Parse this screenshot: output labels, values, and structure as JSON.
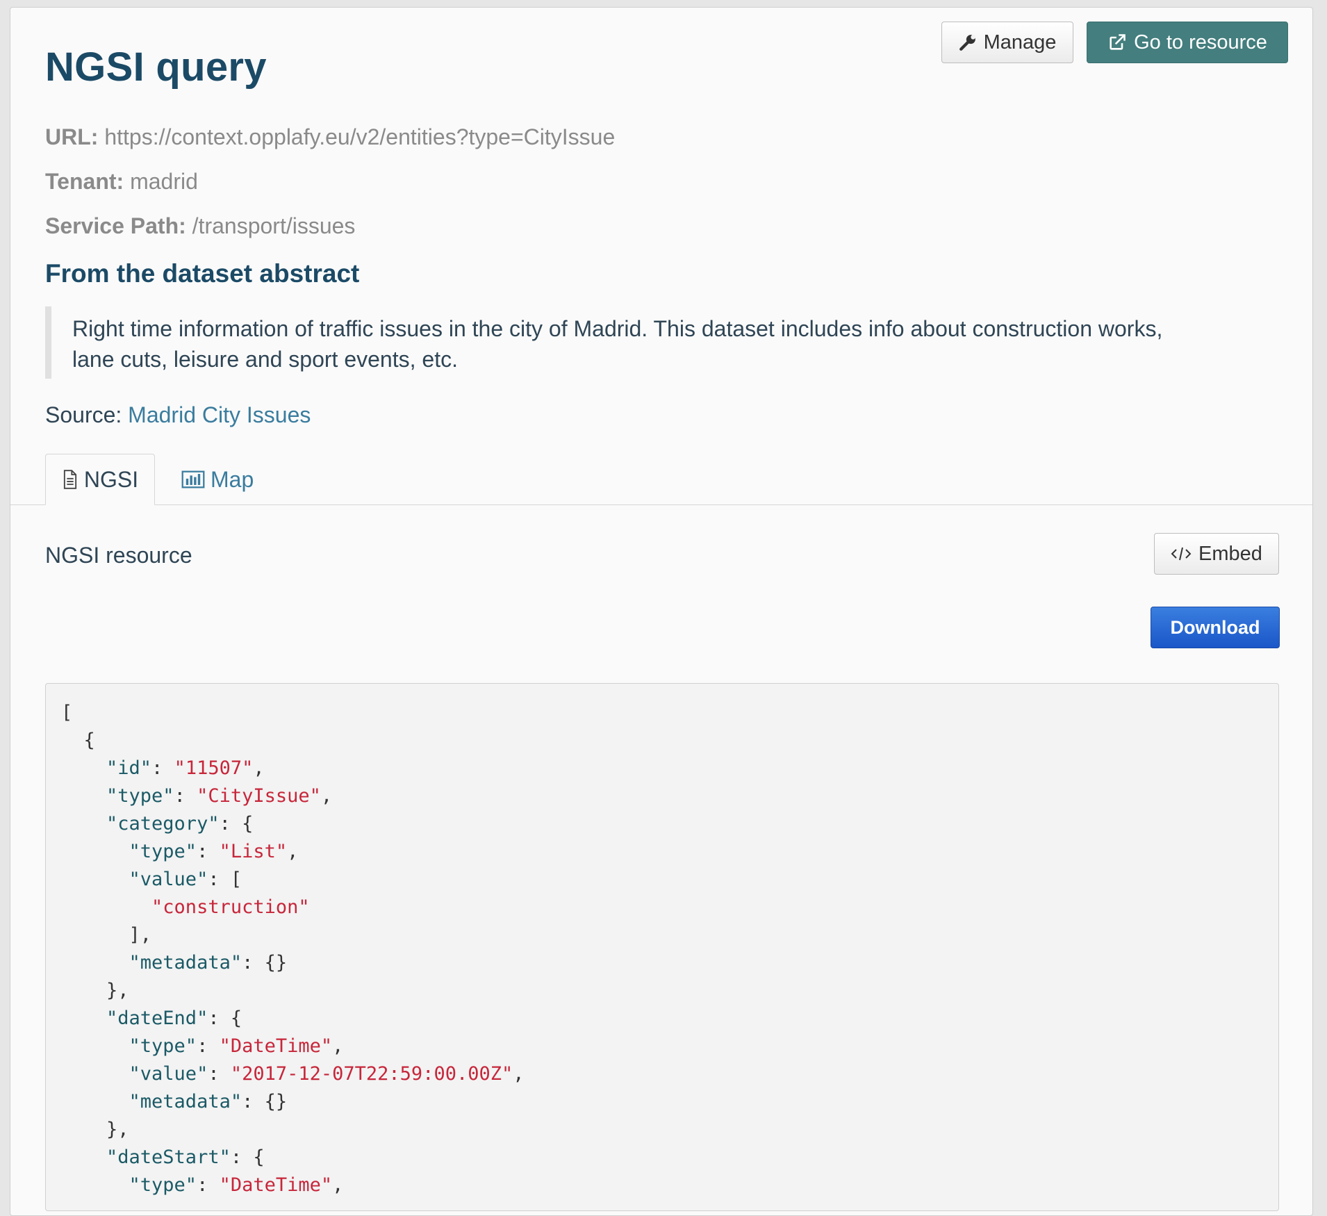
{
  "header": {
    "title": "NGSI query",
    "manage_label": "Manage",
    "goto_label": "Go to resource"
  },
  "meta": {
    "url_label": "URL:",
    "url_value": "https://context.opplafy.eu/v2/entities?type=CityIssue",
    "tenant_label": "Tenant:",
    "tenant_value": "madrid",
    "service_path_label": "Service Path:",
    "service_path_value": "/transport/issues"
  },
  "abstract": {
    "heading": "From the dataset abstract",
    "line1": "Right time information of traffic issues in the city of Madrid. This dataset includes info about construction works,",
    "line2": "lane cuts, leisure and sport events, etc."
  },
  "source": {
    "label": "Source:",
    "link_text": "Madrid City Issues"
  },
  "tabs": [
    {
      "label": "NGSI",
      "icon": "document-icon",
      "active": true
    },
    {
      "label": "Map",
      "icon": "bar-chart-icon",
      "active": false
    }
  ],
  "resource": {
    "label": "NGSI resource",
    "embed_label": "Embed",
    "download_label": "Download"
  },
  "code_lines": [
    [
      {
        "t": "p",
        "v": "["
      }
    ],
    [
      {
        "t": "p",
        "v": "  {"
      }
    ],
    [
      {
        "t": "k",
        "v": "    \"id\""
      },
      {
        "t": "p",
        "v": ": "
      },
      {
        "t": "s",
        "v": "\"11507\""
      },
      {
        "t": "p",
        "v": ","
      }
    ],
    [
      {
        "t": "k",
        "v": "    \"type\""
      },
      {
        "t": "p",
        "v": ": "
      },
      {
        "t": "s",
        "v": "\"CityIssue\""
      },
      {
        "t": "p",
        "v": ","
      }
    ],
    [
      {
        "t": "k",
        "v": "    \"category\""
      },
      {
        "t": "p",
        "v": ": {"
      }
    ],
    [
      {
        "t": "k",
        "v": "      \"type\""
      },
      {
        "t": "p",
        "v": ": "
      },
      {
        "t": "s",
        "v": "\"List\""
      },
      {
        "t": "p",
        "v": ","
      }
    ],
    [
      {
        "t": "k",
        "v": "      \"value\""
      },
      {
        "t": "p",
        "v": ": ["
      }
    ],
    [
      {
        "t": "s",
        "v": "        \"construction\""
      }
    ],
    [
      {
        "t": "p",
        "v": "      ],"
      }
    ],
    [
      {
        "t": "k",
        "v": "      \"metadata\""
      },
      {
        "t": "p",
        "v": ": {}"
      }
    ],
    [
      {
        "t": "p",
        "v": "    },"
      }
    ],
    [
      {
        "t": "k",
        "v": "    \"dateEnd\""
      },
      {
        "t": "p",
        "v": ": {"
      }
    ],
    [
      {
        "t": "k",
        "v": "      \"type\""
      },
      {
        "t": "p",
        "v": ": "
      },
      {
        "t": "s",
        "v": "\"DateTime\""
      },
      {
        "t": "p",
        "v": ","
      }
    ],
    [
      {
        "t": "k",
        "v": "      \"value\""
      },
      {
        "t": "p",
        "v": ": "
      },
      {
        "t": "s",
        "v": "\"2017-12-07T22:59:00.00Z\""
      },
      {
        "t": "p",
        "v": ","
      }
    ],
    [
      {
        "t": "k",
        "v": "      \"metadata\""
      },
      {
        "t": "p",
        "v": ": {}"
      }
    ],
    [
      {
        "t": "p",
        "v": "    },"
      }
    ],
    [
      {
        "t": "k",
        "v": "    \"dateStart\""
      },
      {
        "t": "p",
        "v": ": {"
      }
    ],
    [
      {
        "t": "k",
        "v": "      \"type\""
      },
      {
        "t": "p",
        "v": ": "
      },
      {
        "t": "s",
        "v": "\"DateTime\""
      },
      {
        "t": "p",
        "v": ","
      }
    ]
  ]
}
